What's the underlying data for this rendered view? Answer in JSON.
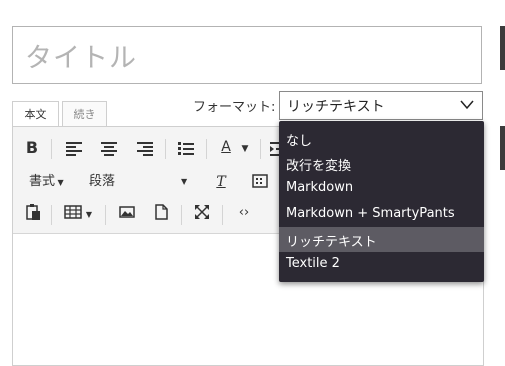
{
  "title": {
    "placeholder": "タイトル"
  },
  "tabs": {
    "main": "本文",
    "continued": "続き"
  },
  "format": {
    "label": "フォーマット:",
    "selected": "リッチテキスト",
    "options": [
      "なし",
      "改行を変換",
      "Markdown",
      "Markdown + SmartyPants",
      "リッチテキスト",
      "Textile 2"
    ]
  },
  "toolbar": {
    "bold": "B",
    "font_color": "A",
    "style_menu": "書式",
    "paragraph_menu": "段落",
    "clear_format": "T"
  }
}
